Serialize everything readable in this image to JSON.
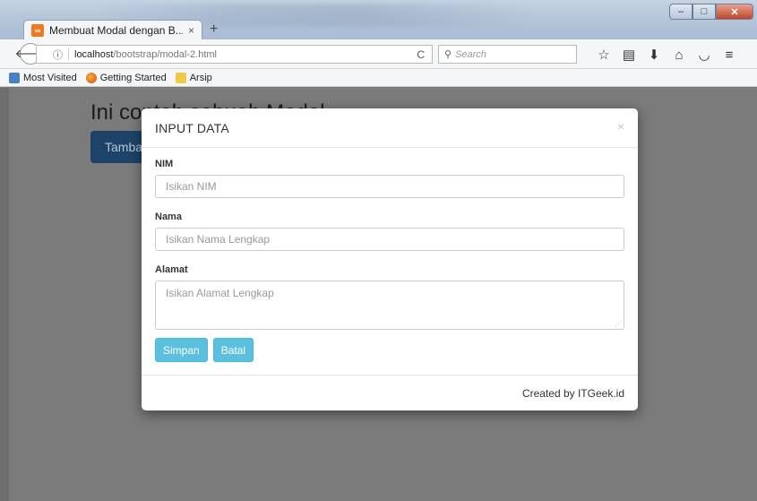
{
  "browser": {
    "tab_title": "Membuat Modal dengan B...",
    "tab_close": "×",
    "new_tab": "+",
    "url_host": "localhost",
    "url_path": "/bootstrap/modal-2.html",
    "search_placeholder": "Search",
    "bookmarks": [
      "Most Visited",
      "Getting Started",
      "Arsip"
    ]
  },
  "page": {
    "heading": "Ini contoh sebuah Modal",
    "button_label": "Tambah"
  },
  "modal": {
    "title": "INPUT DATA",
    "close": "×",
    "fields": [
      {
        "label": "NIM",
        "placeholder": "Isikan NIM"
      },
      {
        "label": "Nama",
        "placeholder": "Isikan Nama Lengkap"
      },
      {
        "label": "Alamat",
        "placeholder": "Isikan Alamat Lengkap"
      }
    ],
    "save_label": "Simpan",
    "cancel_label": "Batal",
    "footer": "Created by ITGeek.id"
  }
}
